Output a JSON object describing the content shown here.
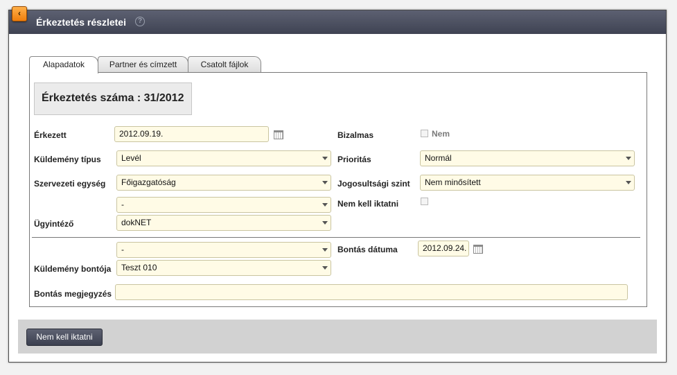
{
  "window": {
    "back_glyph": "‹",
    "title": "Érkeztetés részletei",
    "help_glyph": "?"
  },
  "tabs": [
    {
      "label": "Alapadatok",
      "active": true
    },
    {
      "label": "Partner és címzett",
      "active": false
    },
    {
      "label": "Csatolt fájlok",
      "active": false
    }
  ],
  "header": {
    "title": "Érkeztetés száma : 31/2012"
  },
  "form": {
    "erkezett": {
      "label": "Érkezett",
      "value": "2012.09.19."
    },
    "kuldemeny_tipus": {
      "label": "Küldemény típus",
      "value": "Levél"
    },
    "szervezeti_egyseg": {
      "label": "Szervezeti egység",
      "value": "Főigazgatóság"
    },
    "szervezeti_egyseg_sub": {
      "value": "-"
    },
    "ugyintezo": {
      "label": "Ügyintéző",
      "value": "dokNET"
    },
    "bizalmas": {
      "label": "Bizalmas",
      "checkbox_label": "Nem",
      "checked": false
    },
    "prioritas": {
      "label": "Prioritás",
      "value": "Normál"
    },
    "jogosultsagi_szint": {
      "label": "Jogosultsági szint",
      "value": "Nem minősített"
    },
    "nem_kell_iktatni": {
      "label": "Nem kell iktatni",
      "checked": false
    },
    "bontoja_sub": {
      "value": "-"
    },
    "kuldemeny_bontoja": {
      "label": "Küldemény bontója",
      "value": "Teszt 010"
    },
    "bontas_datuma": {
      "label": "Bontás dátuma",
      "value": "2012.09.24."
    },
    "bontas_megjegyzes": {
      "label": "Bontás megjegyzés",
      "value": ""
    }
  },
  "footer": {
    "button_label": "Nem kell iktatni"
  },
  "colors": {
    "titlebar": "#4a4e5e",
    "accent_orange": "#f59a2a",
    "field_bg": "#fffbe6",
    "footer_bg": "#d2d2d2"
  }
}
